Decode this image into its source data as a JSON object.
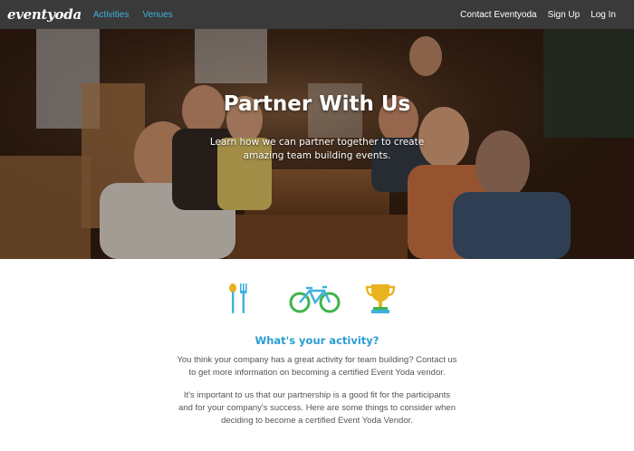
{
  "nav": {
    "logo": "eventyoda",
    "left_links": [
      "Activities",
      "Venues"
    ],
    "right_links": [
      "Contact Eventyoda",
      "Sign Up",
      "Log In"
    ]
  },
  "hero": {
    "title": "Partner With Us",
    "subtitle": "Learn how we can partner together to create amazing team building events."
  },
  "icons": [
    "utensils-icon",
    "bicycle-icon",
    "trophy-icon"
  ],
  "colors": {
    "accent": "#2a9ed0",
    "nav_bg": "#3a3a3a",
    "icon_blue": "#3fb1dc",
    "icon_green": "#3db54a",
    "icon_gold": "#e8b31e"
  },
  "content": {
    "section_title": "What's your activity?",
    "paragraph_1": "You think your company has a great activity for team building? Contact us to get more information on becoming a certified Event Yoda vendor.",
    "paragraph_2": "It's important to us that our partnership is a good fit for the participants and for your company's success. Here are some things to consider when deciding to become a certified Event Yoda Vendor."
  }
}
